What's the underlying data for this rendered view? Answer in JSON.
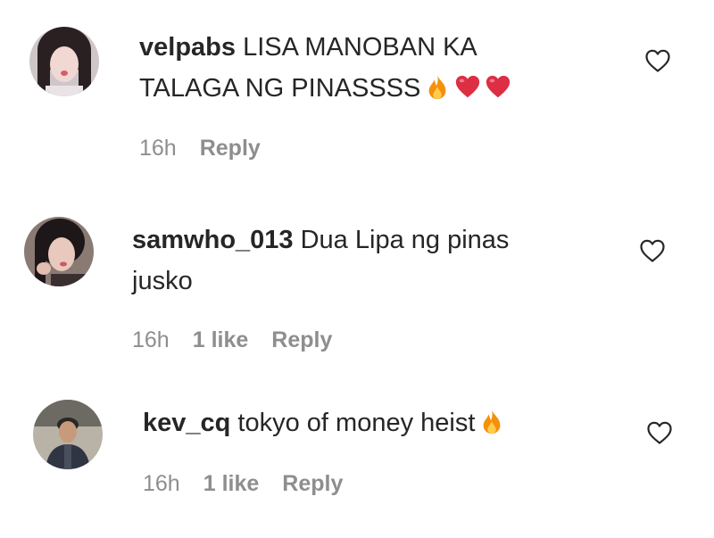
{
  "comments": [
    {
      "username": "velpabs",
      "text_line1": "LISA MANOBAN KA",
      "text_line2": "TALAGA NG PINASSSS",
      "emojis": [
        "fire-emoji",
        "heart-emoji",
        "heart-emoji"
      ],
      "time": "16h",
      "likes": "",
      "reply_label": "Reply"
    },
    {
      "username": "samwho_013",
      "text_line1": "Dua Lipa ng pinas",
      "text_line2": "jusko",
      "emojis": [],
      "time": "16h",
      "likes": "1 like",
      "reply_label": "Reply"
    },
    {
      "username": "kev_cq",
      "text_line1": "tokyo of money heist",
      "text_line2": "",
      "emojis": [
        "fire-emoji"
      ],
      "time": "16h",
      "likes": "1 like",
      "reply_label": "Reply"
    }
  ],
  "colors": {
    "text": "#262626",
    "meta": "#8e8e8e",
    "heart": "#ed2b3d",
    "fire": "#f4900c"
  },
  "icons": {
    "like": "heart-outline-icon"
  }
}
